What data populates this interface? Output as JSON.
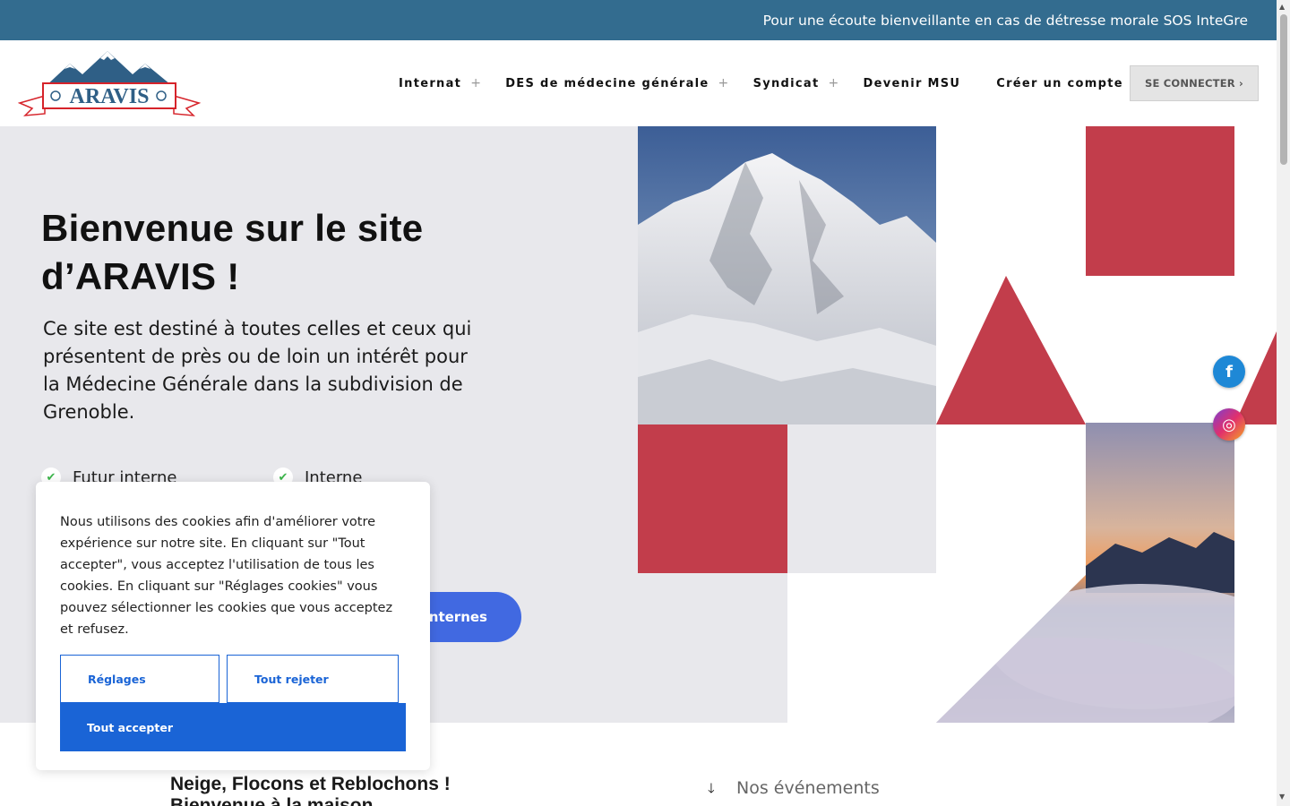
{
  "topbar": {
    "message": "Pour une écoute bienveillante en cas de détresse morale",
    "link": "SOS InteGre"
  },
  "logo": {
    "text": "ARAVIS"
  },
  "nav": [
    {
      "label": "Internat",
      "has_submenu": true
    },
    {
      "label": "DES de médecine générale",
      "has_submenu": true
    },
    {
      "label": "Syndicat",
      "has_submenu": true
    },
    {
      "label": "Devenir MSU",
      "has_submenu": false
    },
    {
      "label": "Créer un compte",
      "has_submenu": false
    }
  ],
  "nav_plus": "+",
  "connect_label": "SE CONNECTER ›",
  "hero": {
    "title_line1": "Bienvenue sur le site",
    "title_line2": "d’ARAVIS !",
    "text": "Ce site est destiné à toutes celles et ceux qui présentent de près ou de loin un intérêt pour la Médecine Générale dans la subdivision de Grenoble.",
    "checks": [
      "Futur interne",
      "Interne"
    ],
    "cta_partial": "-internes"
  },
  "colors": {
    "topbar": "#336c8f",
    "accent_red": "#c23d4b",
    "cta_blue": "#4169e1",
    "cookie_blue": "#1a64d6",
    "hero_grey": "#e8e8ec"
  },
  "social": [
    {
      "name": "facebook",
      "glyph": "f"
    },
    {
      "name": "instagram",
      "glyph": "◎"
    }
  ],
  "lower": {
    "title_line1": "Neige, Flocons et Reblochons !",
    "title_line2": "Bienvenue à la maison",
    "events_label": "Nos événements",
    "events_icon": "arrow-down-icon"
  },
  "cookie": {
    "text": "Nous utilisons des cookies afin d'améliorer votre expérience sur notre site. En cliquant sur \"Tout accepter\", vous acceptez l'utilisation de tous les cookies. En cliquant sur \"Réglages cookies\" vous pouvez sélectionner les cookies que vous acceptez et refusez.",
    "settings_label": "Réglages",
    "reject_label": "Tout rejeter",
    "accept_label": "Tout accepter"
  }
}
